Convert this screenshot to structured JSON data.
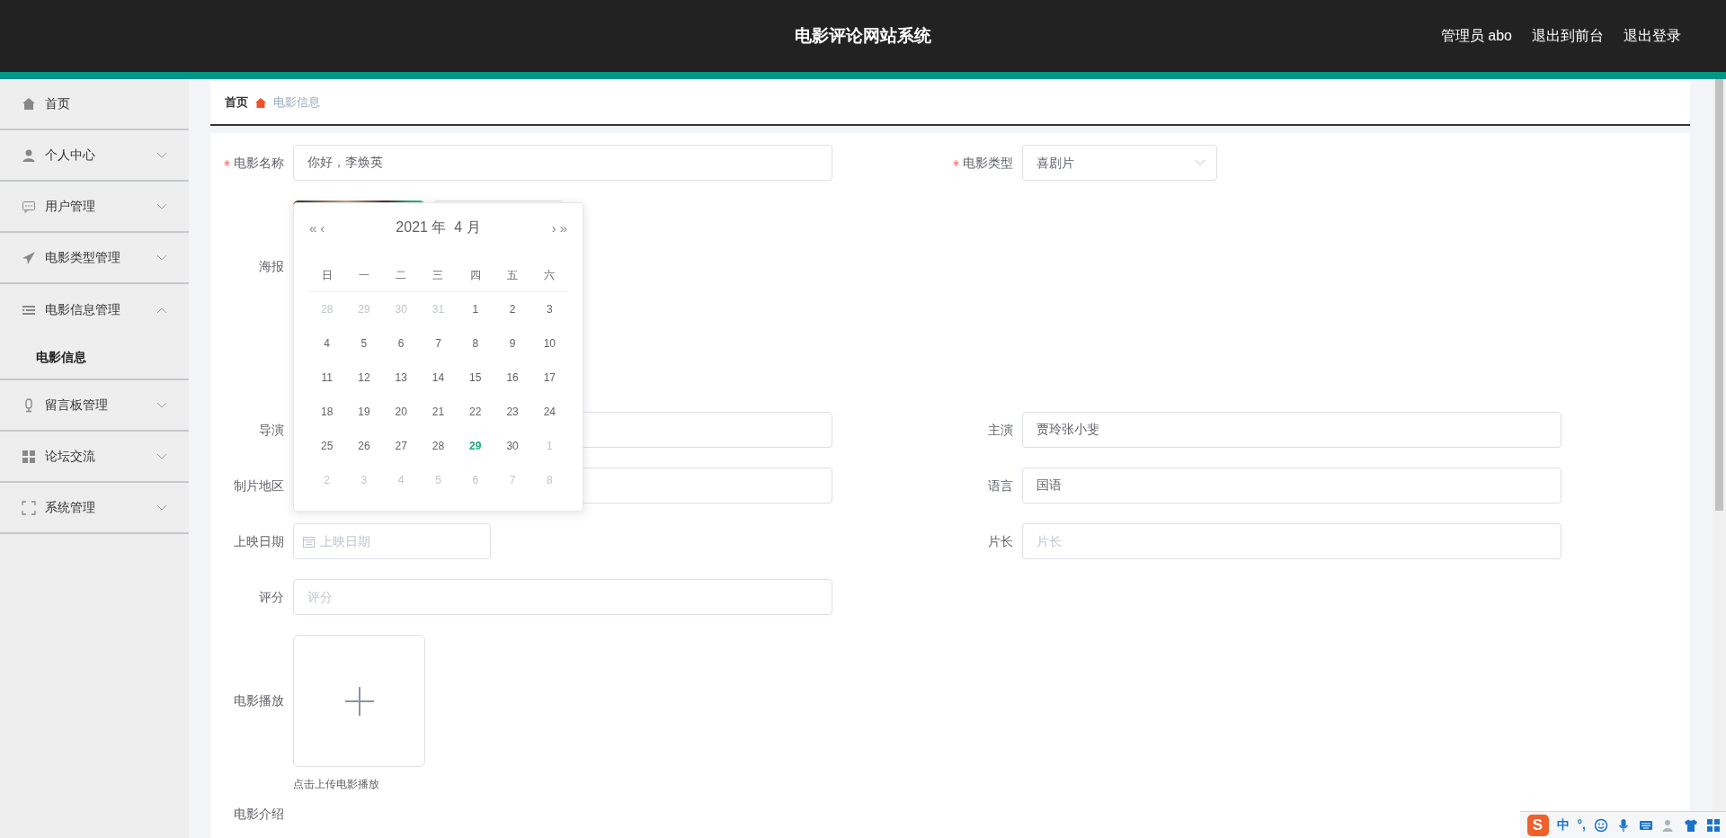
{
  "header": {
    "title": "电影评论网站系统",
    "links": [
      "管理员 abo",
      "退出到前台",
      "退出登录"
    ]
  },
  "sidebar": {
    "items": [
      {
        "kind": "link",
        "label": "首页"
      },
      {
        "kind": "submenu",
        "label": "个人中心",
        "expanded": false
      },
      {
        "kind": "submenu",
        "label": "用户管理",
        "expanded": false
      },
      {
        "kind": "submenu",
        "label": "电影类型管理",
        "expanded": false
      },
      {
        "kind": "submenu",
        "label": "电影信息管理",
        "expanded": true,
        "children": [
          {
            "label": "电影信息",
            "selected": true
          }
        ]
      },
      {
        "kind": "submenu",
        "label": "留言板管理",
        "expanded": false
      },
      {
        "kind": "submenu",
        "label": "论坛交流",
        "expanded": false
      },
      {
        "kind": "submenu",
        "label": "系统管理",
        "expanded": false
      }
    ]
  },
  "breadcrumb": [
    "首页",
    "电影信息"
  ],
  "form": {
    "rows": [
      [
        {
          "kind": "text",
          "label": "电影名称",
          "required": true,
          "value": "你好，李焕英"
        },
        {
          "kind": "select",
          "label": "电影类型",
          "required": true,
          "value": "喜剧片"
        }
      ],
      [
        {
          "kind": "poster",
          "label": "海报",
          "required": false
        }
      ],
      [
        {
          "kind": "text",
          "label": "导演",
          "required": false
        },
        {
          "kind": "text",
          "label": "主演",
          "required": false,
          "value": "贾玲张小斐"
        }
      ],
      [
        {
          "kind": "text",
          "label": "制片地区",
          "required": false
        },
        {
          "kind": "text",
          "label": "语言",
          "required": false,
          "value": "国语"
        }
      ],
      [
        {
          "kind": "date",
          "label": "上映日期",
          "required": false,
          "placeholder": "上映日期",
          "picker": {
            "title": "2021 年  4 月",
            "prev": [
              "«",
              "‹"
            ],
            "next": [
              "›",
              "»"
            ],
            "weekdays": [
              "日",
              "一",
              "二",
              "三",
              "四",
              "五",
              "六"
            ],
            "days": [
              {
                "label": "28",
                "outside": true,
                "selected": false
              },
              {
                "label": "29",
                "outside": true,
                "selected": false
              },
              {
                "label": "30",
                "outside": true,
                "selected": false
              },
              {
                "label": "31",
                "outside": true,
                "selected": false
              },
              {
                "label": "1",
                "outside": false,
                "selected": false
              },
              {
                "label": "2",
                "outside": false,
                "selected": false
              },
              {
                "label": "3",
                "outside": false,
                "selected": false
              },
              {
                "label": "4",
                "outside": false,
                "selected": false
              },
              {
                "label": "5",
                "outside": false,
                "selected": false
              },
              {
                "label": "6",
                "outside": false,
                "selected": false
              },
              {
                "label": "7",
                "outside": false,
                "selected": false
              },
              {
                "label": "8",
                "outside": false,
                "selected": false
              },
              {
                "label": "9",
                "outside": false,
                "selected": false
              },
              {
                "label": "10",
                "outside": false,
                "selected": false
              },
              {
                "label": "11",
                "outside": false,
                "selected": false
              },
              {
                "label": "12",
                "outside": false,
                "selected": false
              },
              {
                "label": "13",
                "outside": false,
                "selected": false
              },
              {
                "label": "14",
                "outside": false,
                "selected": false
              },
              {
                "label": "15",
                "outside": false,
                "selected": false
              },
              {
                "label": "16",
                "outside": false,
                "selected": false
              },
              {
                "label": "17",
                "outside": false,
                "selected": false
              },
              {
                "label": "18",
                "outside": false,
                "selected": false
              },
              {
                "label": "19",
                "outside": false,
                "selected": false
              },
              {
                "label": "20",
                "outside": false,
                "selected": false
              },
              {
                "label": "21",
                "outside": false,
                "selected": false
              },
              {
                "label": "22",
                "outside": false,
                "selected": false
              },
              {
                "label": "23",
                "outside": false,
                "selected": false
              },
              {
                "label": "24",
                "outside": false,
                "selected": false
              },
              {
                "label": "25",
                "outside": false,
                "selected": false
              },
              {
                "label": "26",
                "outside": false,
                "selected": false
              },
              {
                "label": "27",
                "outside": false,
                "selected": false
              },
              {
                "label": "28",
                "outside": false,
                "selected": false
              },
              {
                "label": "29",
                "outside": false,
                "selected": true
              },
              {
                "label": "30",
                "outside": false,
                "selected": false
              },
              {
                "label": "1",
                "outside": true,
                "selected": false
              },
              {
                "label": "2",
                "outside": true,
                "selected": false
              },
              {
                "label": "3",
                "outside": true,
                "selected": false
              },
              {
                "label": "4",
                "outside": true,
                "selected": false
              },
              {
                "label": "5",
                "outside": true,
                "selected": false
              },
              {
                "label": "6",
                "outside": true,
                "selected": false
              },
              {
                "label": "7",
                "outside": true,
                "selected": false
              },
              {
                "label": "8",
                "outside": true,
                "selected": false
              }
            ]
          }
        },
        {
          "kind": "text",
          "label": "片长",
          "required": false,
          "placeholder": "片长"
        }
      ],
      [
        {
          "kind": "text",
          "label": "评分",
          "required": false,
          "placeholder": "评分"
        }
      ],
      [
        {
          "kind": "video",
          "label": "电影播放",
          "required": false,
          "hint": "点击上传电影播放"
        }
      ],
      [
        {
          "kind": "offscreen",
          "label": "电影介绍",
          "required": false
        }
      ]
    ]
  },
  "ime_toolbar": {
    "logo": "S",
    "mode": "中",
    "punctuation": "°,"
  }
}
